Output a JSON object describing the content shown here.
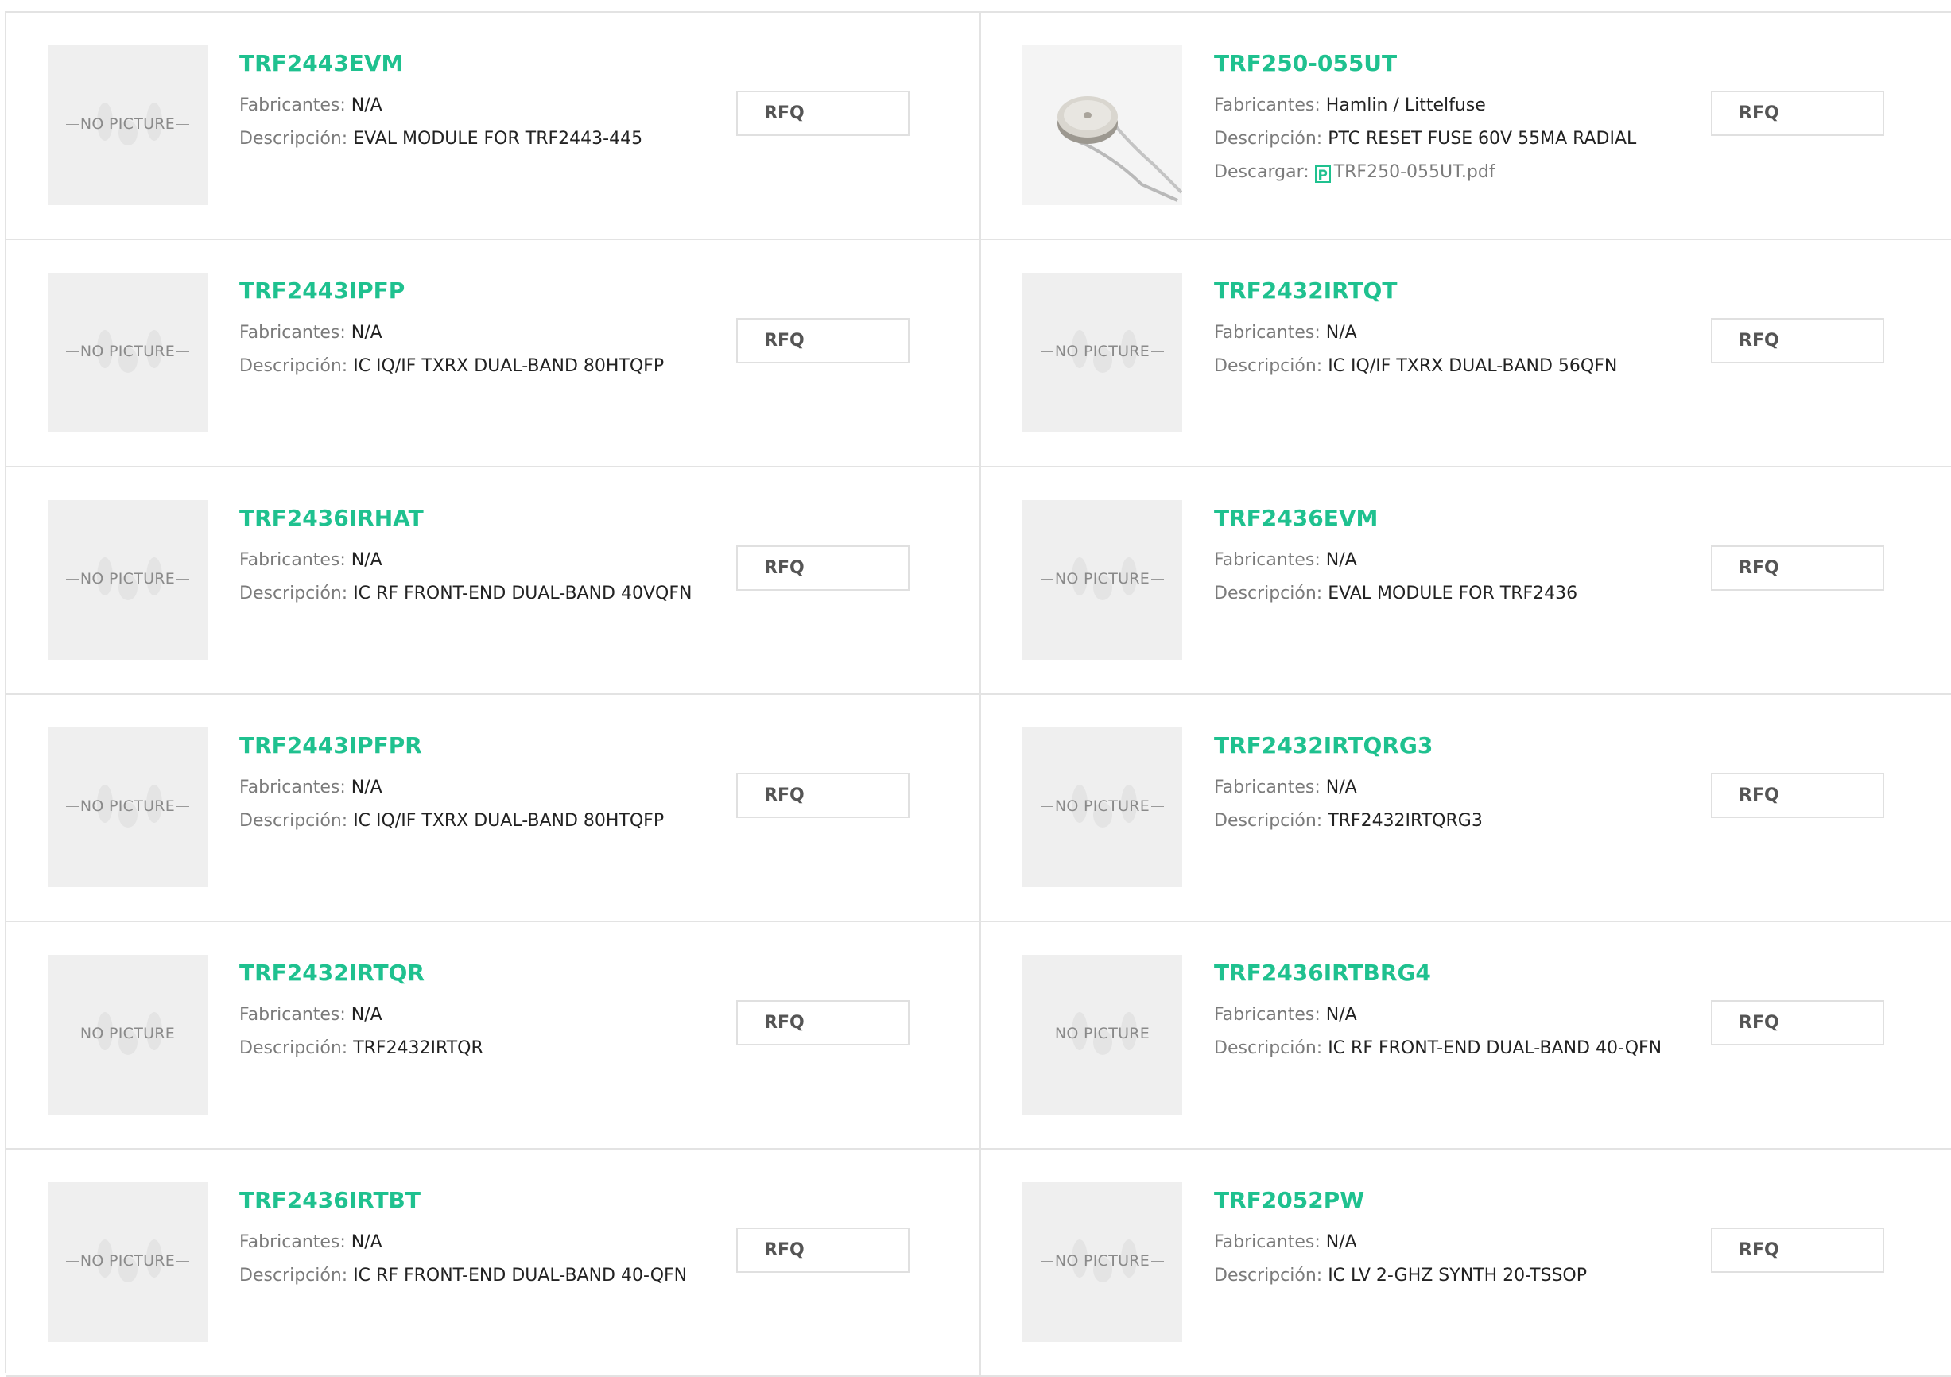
{
  "labels": {
    "manufacturer": "Fabricantes:",
    "description": "Descripción:",
    "download": "Descargar:",
    "rfq": "RFQ",
    "no_picture": "NO PICTURE"
  },
  "colors": {
    "part_number": "#1fc18f",
    "label": "#7b7b7b",
    "border": "#e3e3e3"
  },
  "products": [
    {
      "part": "TRF2443EVM",
      "manufacturer": "N/A",
      "description": "EVAL MODULE FOR TRF2443-445"
    },
    {
      "part": "TRF250-055UT",
      "manufacturer": "Hamlin / Littelfuse",
      "description": "PTC RESET FUSE 60V 55MA RADIAL",
      "download": "TRF250-055UT.pdf",
      "image": "fuse-photo"
    },
    {
      "part": "TRF2443IPFP",
      "manufacturer": "N/A",
      "description": "IC IQ/IF TXRX DUAL-BAND 80HTQFP"
    },
    {
      "part": "TRF2432IRTQT",
      "manufacturer": "N/A",
      "description": "IC IQ/IF TXRX DUAL-BAND 56QFN"
    },
    {
      "part": "TRF2436IRHAT",
      "manufacturer": "N/A",
      "description": "IC RF FRONT-END DUAL-BAND 40VQFN"
    },
    {
      "part": "TRF2436EVM",
      "manufacturer": "N/A",
      "description": "EVAL MODULE FOR TRF2436"
    },
    {
      "part": "TRF2443IPFPR",
      "manufacturer": "N/A",
      "description": "IC IQ/IF TXRX DUAL-BAND 80HTQFP"
    },
    {
      "part": "TRF2432IRTQRG3",
      "manufacturer": "N/A",
      "description": "TRF2432IRTQRG3"
    },
    {
      "part": "TRF2432IRTQR",
      "manufacturer": "N/A",
      "description": "TRF2432IRTQR"
    },
    {
      "part": "TRF2436IRTBRG4",
      "manufacturer": "N/A",
      "description": "IC RF FRONT-END DUAL-BAND 40-QFN"
    },
    {
      "part": "TRF2436IRTBT",
      "manufacturer": "N/A",
      "description": "IC RF FRONT-END DUAL-BAND 40-QFN"
    },
    {
      "part": "TRF2052PW",
      "manufacturer": "N/A",
      "description": "IC LV 2-GHZ SYNTH 20-TSSOP"
    }
  ]
}
